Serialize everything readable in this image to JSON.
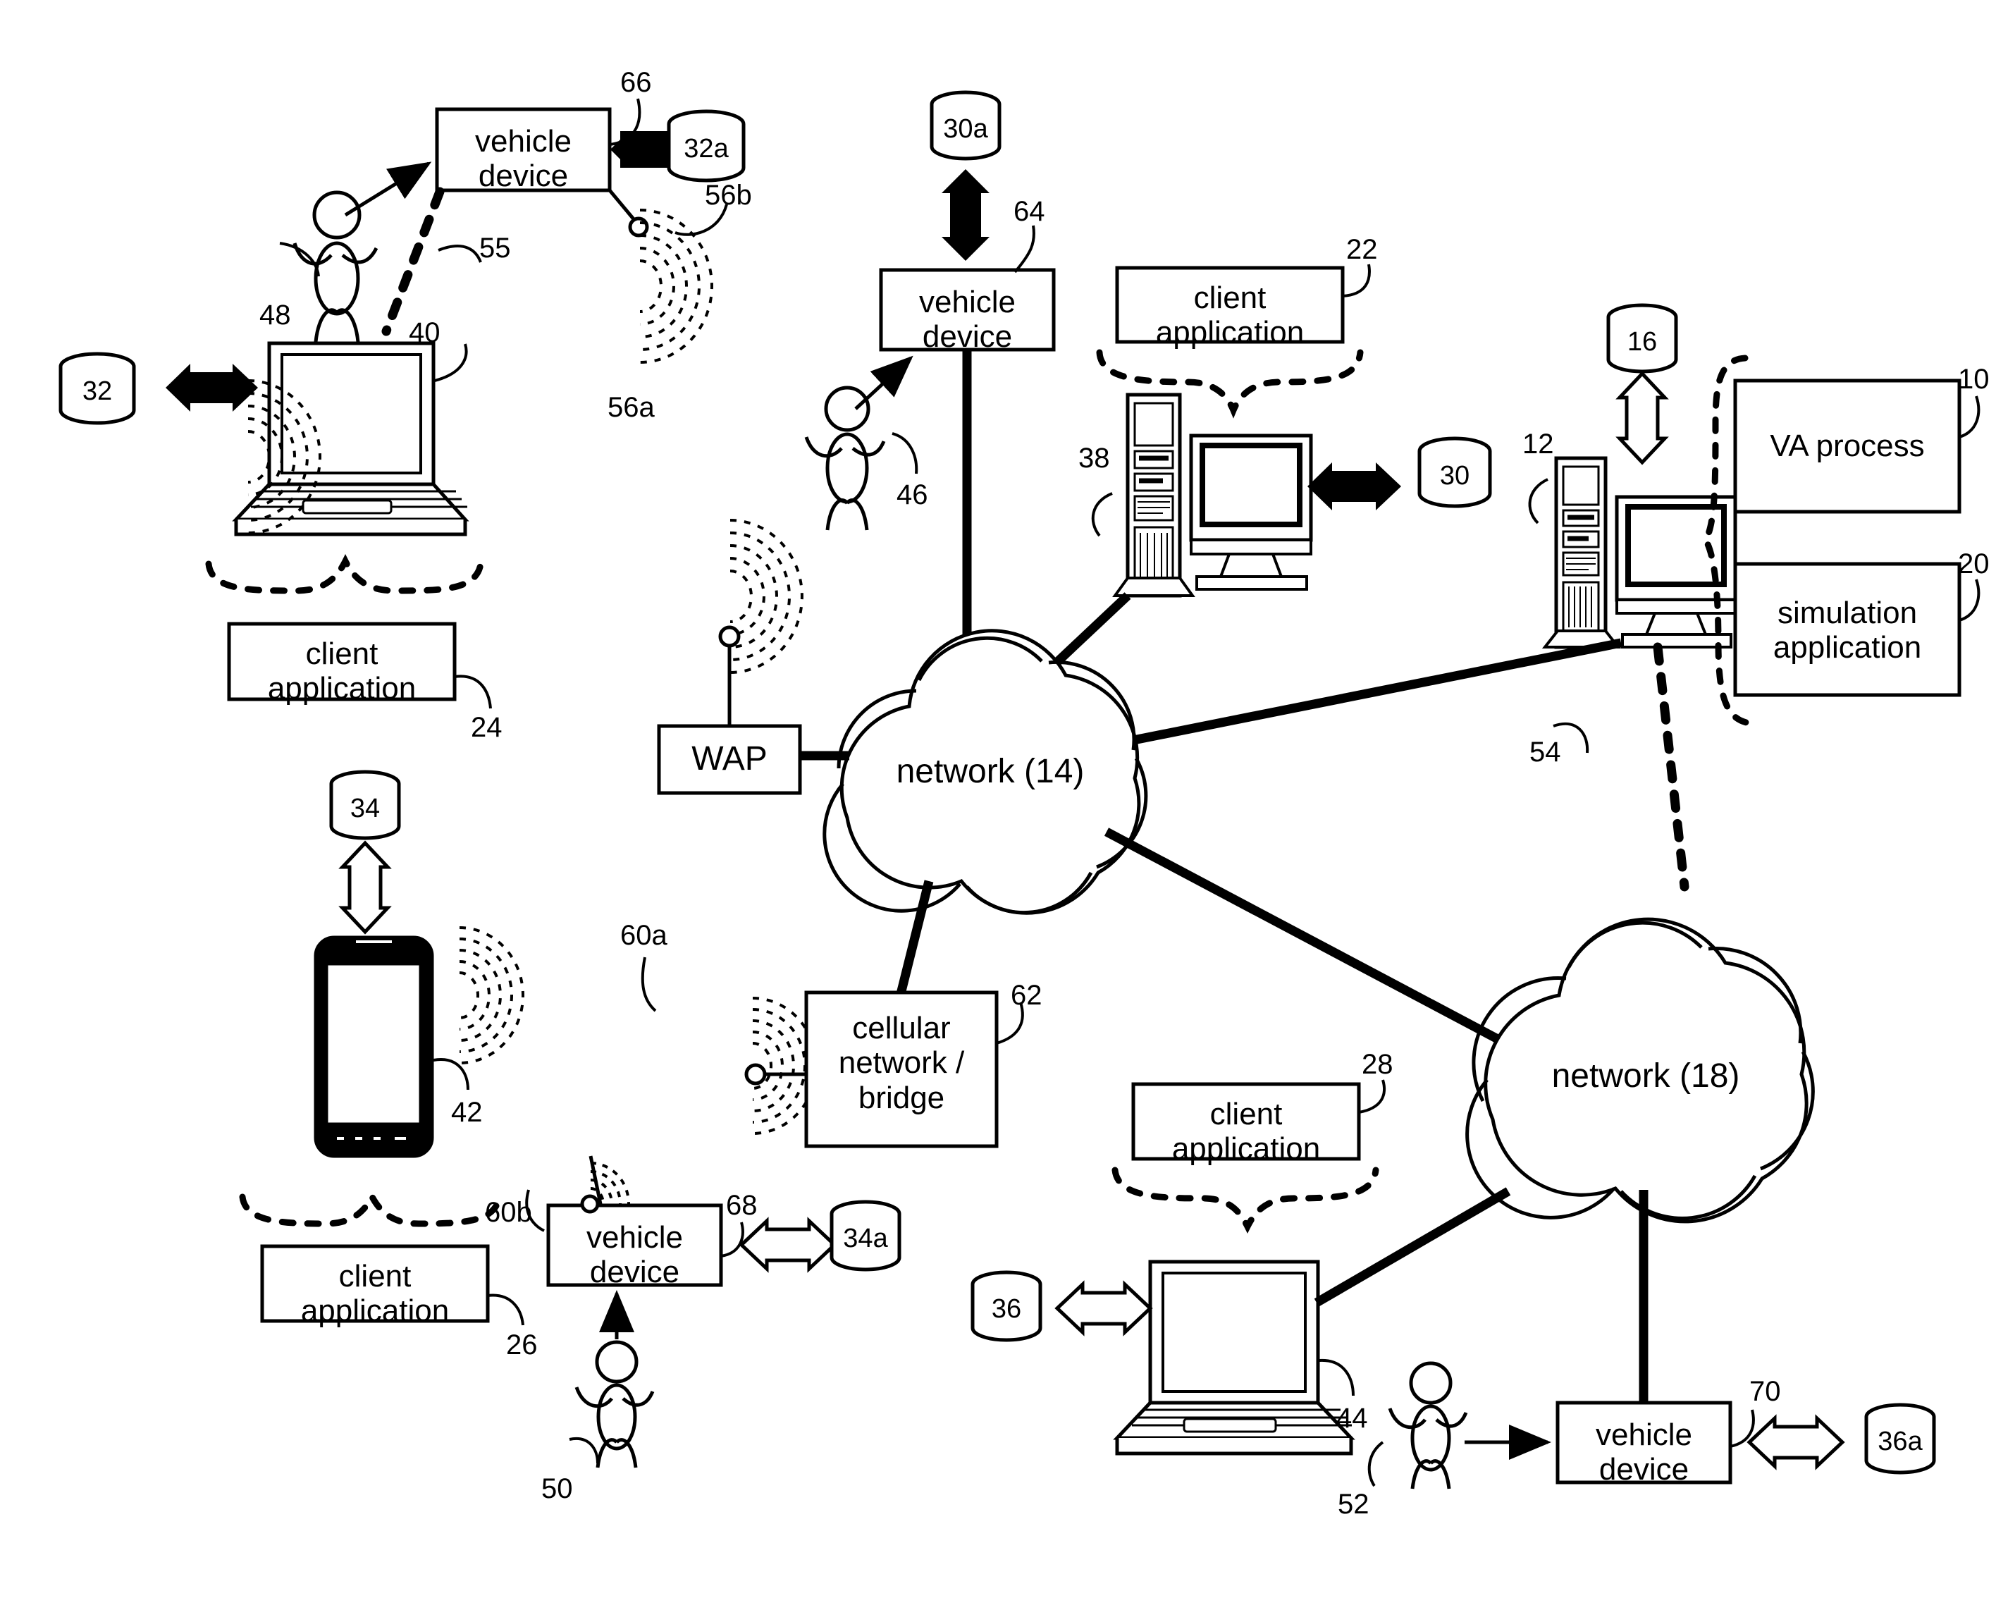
{
  "figure": {
    "type": "patent-network-diagram",
    "title": "",
    "background": "#ffffff",
    "stroke": "#000000"
  },
  "nodes": {
    "vehicle_device_top_left": {
      "label": "vehicle\ndevice",
      "ref": "66"
    },
    "db_32a": {
      "label": "32a"
    },
    "db_32": {
      "label": "32"
    },
    "laptop_40": {
      "ref": "40"
    },
    "person_48": {
      "ref": "48"
    },
    "dashed_link_55": {
      "ref": "55"
    },
    "waves_56a": {
      "ref": "56a"
    },
    "waves_56b": {
      "ref": "56b"
    },
    "db_30a": {
      "label": "30a"
    },
    "vehicle_device_center": {
      "label": "vehicle\ndevice",
      "ref": "64"
    },
    "person_46": {
      "ref": "46"
    },
    "client_application_22": {
      "label": "client\napplication",
      "ref": "22"
    },
    "server_38": {
      "ref": "38"
    },
    "db_30": {
      "label": "30"
    },
    "db_16": {
      "label": "16"
    },
    "server_12": {
      "ref": "12"
    },
    "va_process_10": {
      "label": "VA process",
      "ref": "10"
    },
    "simulation_application_20": {
      "label": "simulation\napplication",
      "ref": "20"
    },
    "dashed_link_54": {
      "ref": "54"
    },
    "client_application_24": {
      "label": "client\napplication",
      "ref": "24"
    },
    "wap": {
      "label": "WAP"
    },
    "network_14": {
      "label": "network (14)"
    },
    "db_34": {
      "label": "34"
    },
    "phone_42": {
      "ref": "42"
    },
    "client_application_26": {
      "label": "client\napplication",
      "ref": "26"
    },
    "waves_60a": {
      "ref": "60a"
    },
    "waves_60b": {
      "ref": "60b"
    },
    "cellular_network_bridge_62": {
      "label": "cellular\nnetwork /\nbridge",
      "ref": "62"
    },
    "vehicle_device_68": {
      "label": "vehicle\ndevice",
      "ref": "68"
    },
    "db_34a": {
      "label": "34a"
    },
    "person_50": {
      "ref": "50"
    },
    "client_application_28": {
      "label": "client\napplication",
      "ref": "28"
    },
    "db_36": {
      "label": "36"
    },
    "laptop_44": {
      "ref": "44"
    },
    "network_18": {
      "label": "network (18)"
    },
    "person_52": {
      "ref": "52"
    },
    "vehicle_device_70": {
      "label": "vehicle\ndevice",
      "ref": "70"
    },
    "db_36a": {
      "label": "36a"
    }
  },
  "reference_numerals": [
    "66",
    "32a",
    "56b",
    "55",
    "48",
    "40",
    "32",
    "56a",
    "30a",
    "64",
    "46",
    "22",
    "38",
    "30",
    "16",
    "12",
    "10",
    "20",
    "54",
    "24",
    "34",
    "42",
    "26",
    "60a",
    "60b",
    "62",
    "68",
    "34a",
    "50",
    "28",
    "36",
    "44",
    "52",
    "70",
    "36a"
  ],
  "text_labels": {
    "vehicle_device": "vehicle\ndevice",
    "client_application": "client\napplication",
    "va_process": "VA process",
    "simulation_application": "simulation\napplication",
    "cellular_network_bridge": "cellular\nnetwork /\nbridge",
    "wap": "WAP",
    "network_14": "network (14)",
    "network_18": "network (18)"
  }
}
